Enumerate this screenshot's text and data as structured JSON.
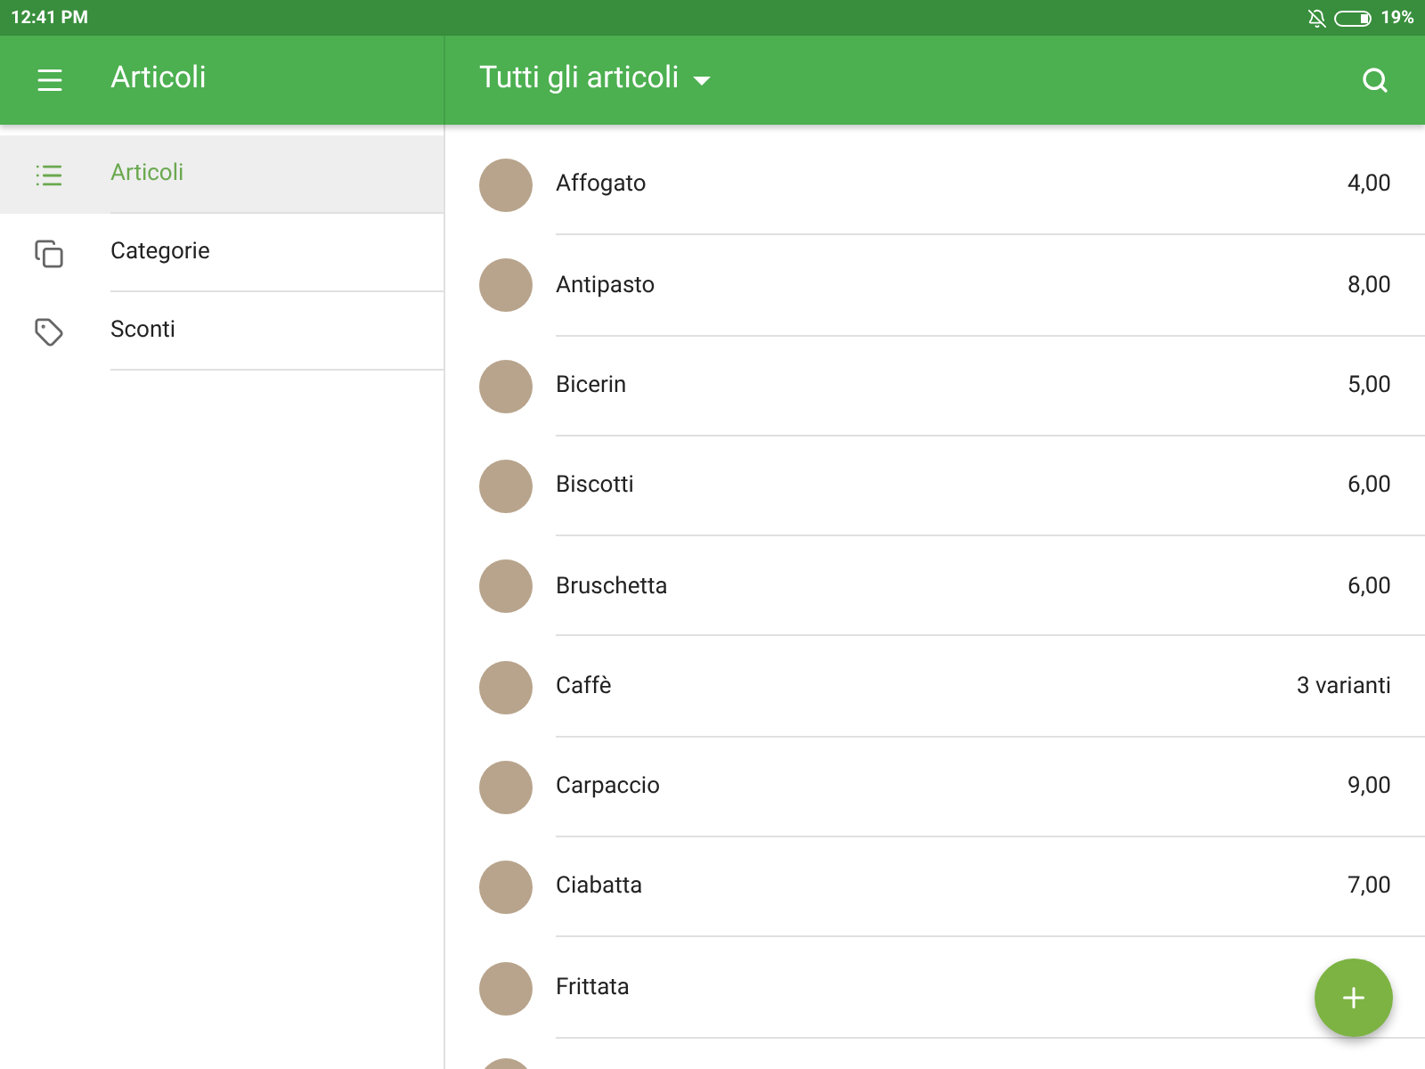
{
  "status_bar": {
    "time": "12:41 PM",
    "battery": "19%"
  },
  "toolbar": {
    "title": "Articoli",
    "filter": "Tutti gli articoli"
  },
  "sidebar": {
    "items": [
      {
        "label": "Articoli",
        "selected": true
      },
      {
        "label": "Categorie",
        "selected": false
      },
      {
        "label": "Sconti",
        "selected": false
      }
    ]
  },
  "items": [
    {
      "name": "Affogato",
      "price": "4,00"
    },
    {
      "name": "Antipasto",
      "price": "8,00"
    },
    {
      "name": "Bicerin",
      "price": "5,00"
    },
    {
      "name": "Biscotti",
      "price": "6,00"
    },
    {
      "name": "Bruschetta",
      "price": "6,00"
    },
    {
      "name": "Caffè",
      "price": "3 varianti"
    },
    {
      "name": "Carpaccio",
      "price": "9,00"
    },
    {
      "name": "Ciabatta",
      "price": "7,00"
    },
    {
      "name": "Frittata"
    }
  ]
}
